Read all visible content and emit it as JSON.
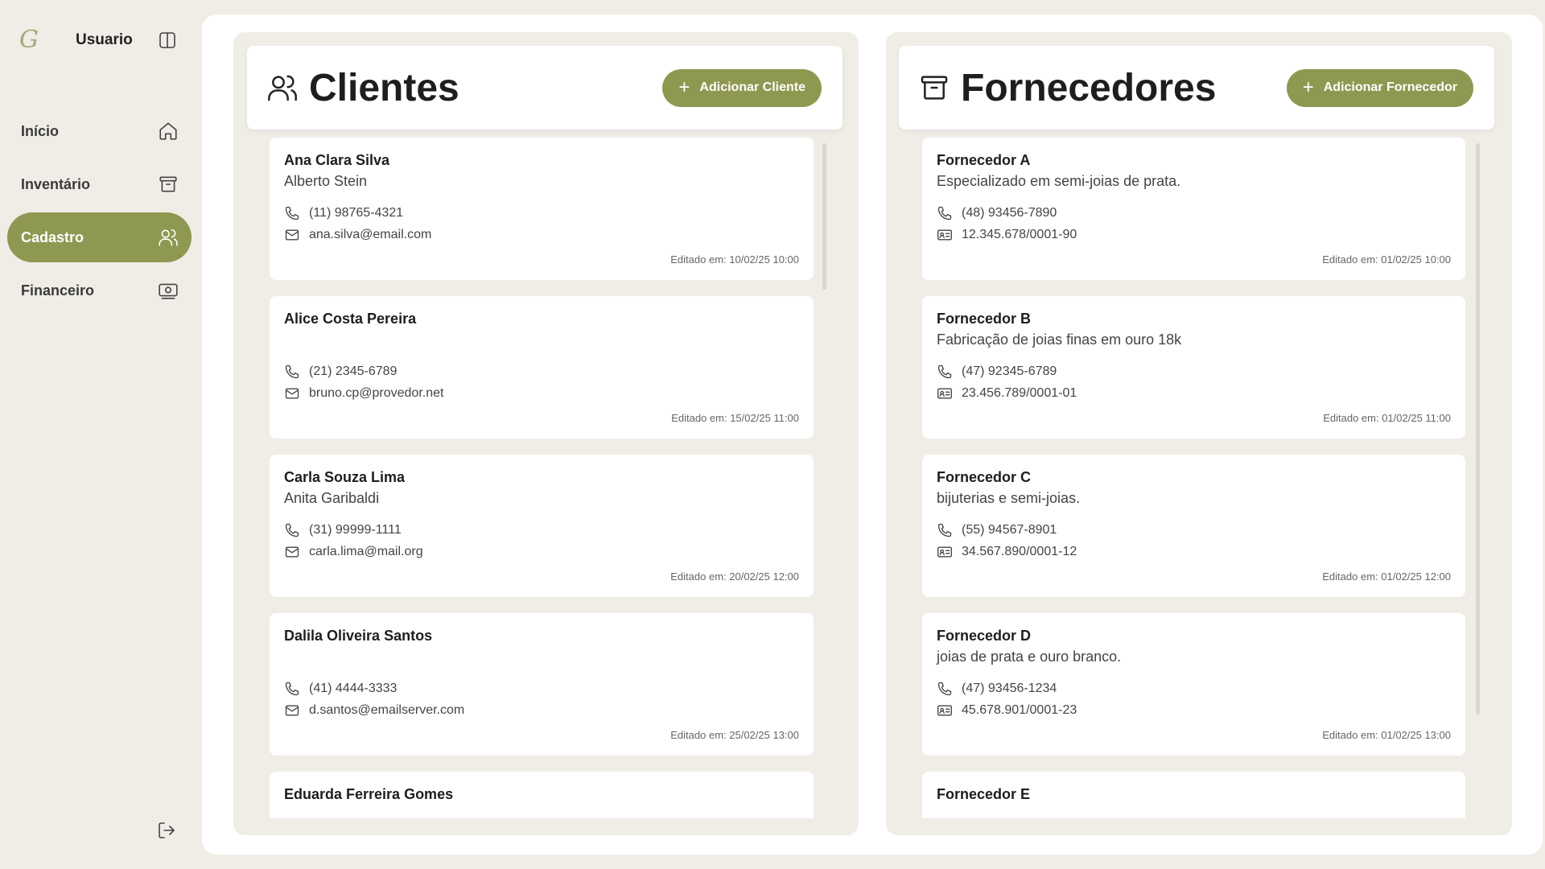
{
  "sidebar": {
    "logo": "G",
    "username": "Usuario",
    "items": [
      {
        "label": "Início",
        "icon": "home-icon",
        "active": false
      },
      {
        "label": "Inventário",
        "icon": "archive-icon",
        "active": false
      },
      {
        "label": "Cadastro",
        "icon": "users-icon",
        "active": true
      },
      {
        "label": "Financeiro",
        "icon": "money-icon",
        "active": false
      }
    ]
  },
  "clientes": {
    "title": "Clientes",
    "add_label": "Adicionar Cliente",
    "items": [
      {
        "name": "Ana Clara Silva",
        "sub": "Alberto Stein",
        "phone": "(11) 98765-4321",
        "email": "ana.silva@email.com",
        "edited": "Editado em: 10/02/25 10:00"
      },
      {
        "name": "Alice Costa Pereira",
        "sub": "",
        "phone": "(21) 2345-6789",
        "email": "bruno.cp@provedor.net",
        "edited": "Editado em: 15/02/25 11:00"
      },
      {
        "name": "Carla Souza Lima",
        "sub": "Anita Garibaldi",
        "phone": "(31) 99999-1111",
        "email": "carla.lima@mail.org",
        "edited": "Editado em: 20/02/25 12:00"
      },
      {
        "name": "Dalila Oliveira Santos",
        "sub": "",
        "phone": "(41) 4444-3333",
        "email": "d.santos@emailserver.com",
        "edited": "Editado em: 25/02/25 13:00"
      },
      {
        "name": "Eduarda Ferreira Gomes",
        "sub": "",
        "phone": "",
        "email": "",
        "edited": ""
      }
    ]
  },
  "fornecedores": {
    "title": "Fornecedores",
    "add_label": "Adicionar Fornecedor",
    "items": [
      {
        "name": "Fornecedor A",
        "sub": "Especializado em semi-joias de prata.",
        "phone": "(48) 93456-7890",
        "cnpj": "12.345.678/0001-90",
        "edited": "Editado em: 01/02/25 10:00"
      },
      {
        "name": "Fornecedor B",
        "sub": "Fabricação de joias finas em ouro 18k",
        "phone": "(47) 92345-6789",
        "cnpj": "23.456.789/0001-01",
        "edited": "Editado em: 01/02/25 11:00"
      },
      {
        "name": "Fornecedor C",
        "sub": "bijuterias e semi-joias.",
        "phone": "(55) 94567-8901",
        "cnpj": "34.567.890/0001-12",
        "edited": "Editado em: 01/02/25 12:00"
      },
      {
        "name": "Fornecedor D",
        "sub": "joias de prata e ouro branco.",
        "phone": "(47) 93456-1234",
        "cnpj": "45.678.901/0001-23",
        "edited": "Editado em: 01/02/25 13:00"
      },
      {
        "name": "Fornecedor E",
        "sub": "",
        "phone": "",
        "cnpj": "",
        "edited": ""
      }
    ]
  },
  "colors": {
    "accent": "#8f9850",
    "background": "#efede6",
    "surface": "#ffffff"
  }
}
